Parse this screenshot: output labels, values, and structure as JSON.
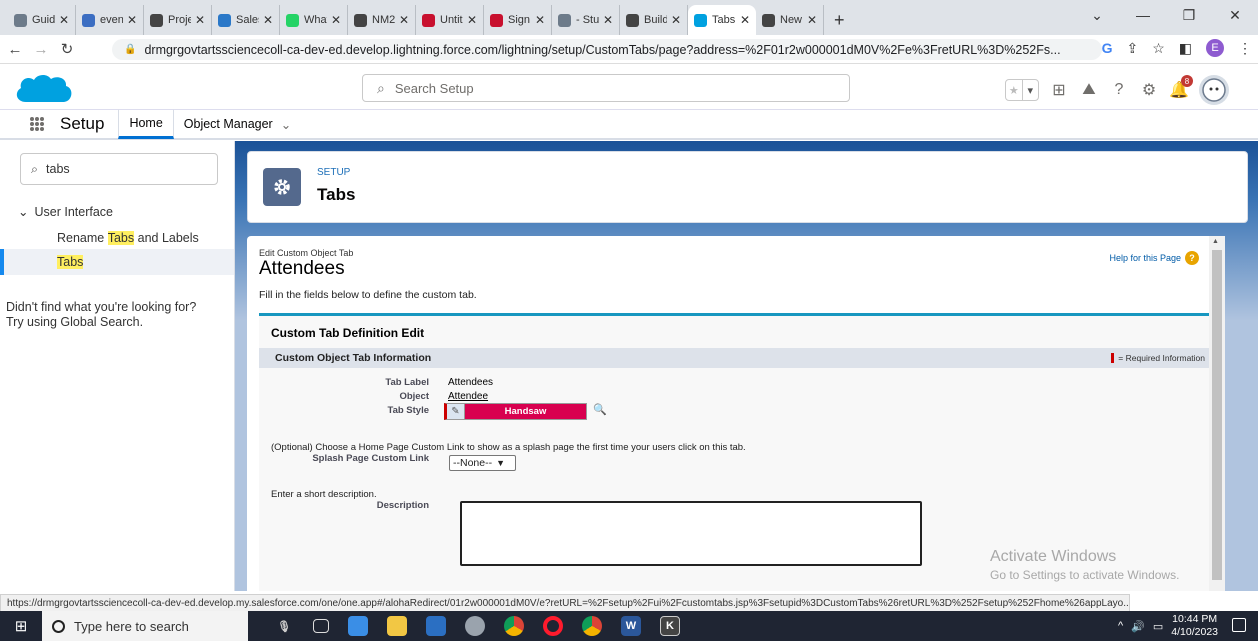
{
  "browser": {
    "tabs": [
      {
        "title": "Guid",
        "color": "#6d7b8a"
      },
      {
        "title": "even",
        "color": "#3c6ec2"
      },
      {
        "title": "Proje",
        "color": "#444444"
      },
      {
        "title": "Sales",
        "color": "#2a78c8"
      },
      {
        "title": "What",
        "color": "#25d366"
      },
      {
        "title": "NM2",
        "color": "#444444"
      },
      {
        "title": "Untit",
        "color": "#c8102e"
      },
      {
        "title": "Sign",
        "color": "#c8102e"
      },
      {
        "title": "- Stu",
        "color": "#6d7b8a"
      },
      {
        "title": "Build",
        "color": "#444444"
      },
      {
        "title": "Tabs",
        "color": "#00a1e0",
        "active": true
      },
      {
        "title": "New",
        "color": "#444444"
      }
    ],
    "url": "drmgrgovtartssciencecoll-ca-dev-ed.develop.lightning.force.com/lightning/setup/CustomTabs/page?address=%2F01r2w000001dM0V%2Fe%3FretURL%3D%252Fs...",
    "profile_letter": "E"
  },
  "sf": {
    "search_placeholder": "Search Setup",
    "notification_count": "8",
    "app_name": "Setup",
    "nav": {
      "home": "Home",
      "object_manager": "Object Manager"
    }
  },
  "sidebar": {
    "quickfind_value": "tabs",
    "group": "User Interface",
    "items": [
      {
        "pre": "Rename ",
        "hl": "Tabs",
        "post": " and Labels",
        "selected": false
      },
      {
        "pre": "",
        "hl": "Tabs",
        "post": "",
        "selected": true
      }
    ],
    "not_found_1": "Didn't find what you're looking for?",
    "not_found_2": "Try using Global Search."
  },
  "header": {
    "eyebrow": "SETUP",
    "title": "Tabs"
  },
  "form": {
    "subtitle": "Edit Custom Object Tab",
    "title": "Attendees",
    "help": "Help for this Page",
    "intro": "Fill in the fields below to define the custom tab.",
    "block_title": "Custom Tab Definition Edit",
    "section_title": "Custom Object Tab Information",
    "required_info": "= Required Information",
    "tab_label_lbl": "Tab Label",
    "tab_label_val": "Attendees",
    "object_lbl": "Object",
    "object_val": "Attendee",
    "tab_style_lbl": "Tab Style",
    "tab_style_val": "Handsaw",
    "optional_text": "(Optional) Choose a Home Page Custom Link to show as a splash page the first time your users click on this tab.",
    "splash_lbl": "Splash Page Custom Link",
    "splash_val": "--None--",
    "short_desc": "Enter a short description.",
    "description_lbl": "Description",
    "description_val": ""
  },
  "watermark": {
    "line1": "Activate Windows",
    "line2": "Go to Settings to activate Windows."
  },
  "status_url": "https://drmgrgovtartssciencecoll-ca-dev-ed.develop.my.salesforce.com/one/one.app#/alohaRedirect/01r2w000001dM0V/e?retURL=%2Fsetup%2Fui%2Fcustomtabs.jsp%3Fsetupid%3DCustomTabs%26retURL%3D%252Fsetup%252Fhome%26appLayo...",
  "taskbar": {
    "search_placeholder": "Type here to search",
    "time": "10:44 PM",
    "date": "4/10/2023"
  },
  "colors": {
    "accent": "#0070d2",
    "setup_icon": "#54698d",
    "tab_style": "#d8004f"
  }
}
